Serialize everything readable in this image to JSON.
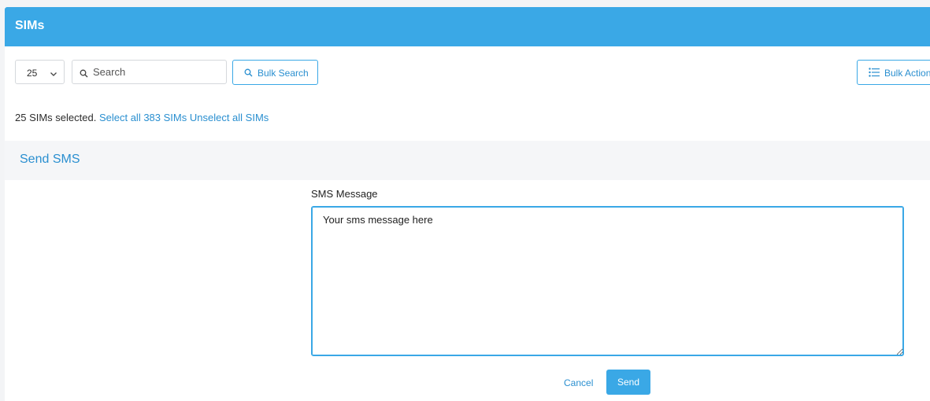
{
  "header": {
    "title": "SIMs"
  },
  "toolbar": {
    "per_page": "25",
    "search_placeholder": "Search",
    "bulk_search_label": "Bulk Search",
    "bulk_action_label": "Bulk Action"
  },
  "selection": {
    "status": "25 SIMs selected.",
    "select_all_link": "Select all 383 SIMs",
    "unselect_all_link": "Unselect all SIMs"
  },
  "send_sms": {
    "title": "Send SMS",
    "message_label": "SMS Message",
    "message_value": "Your sms message here",
    "cancel_label": "Cancel",
    "send_label": "Send"
  },
  "colors": {
    "accent": "#3aa8e6",
    "link": "#2a8fd0"
  },
  "icons": {
    "dropdown": "chevron-down-icon",
    "search": "search-icon",
    "bulk_action": "list-icon"
  }
}
